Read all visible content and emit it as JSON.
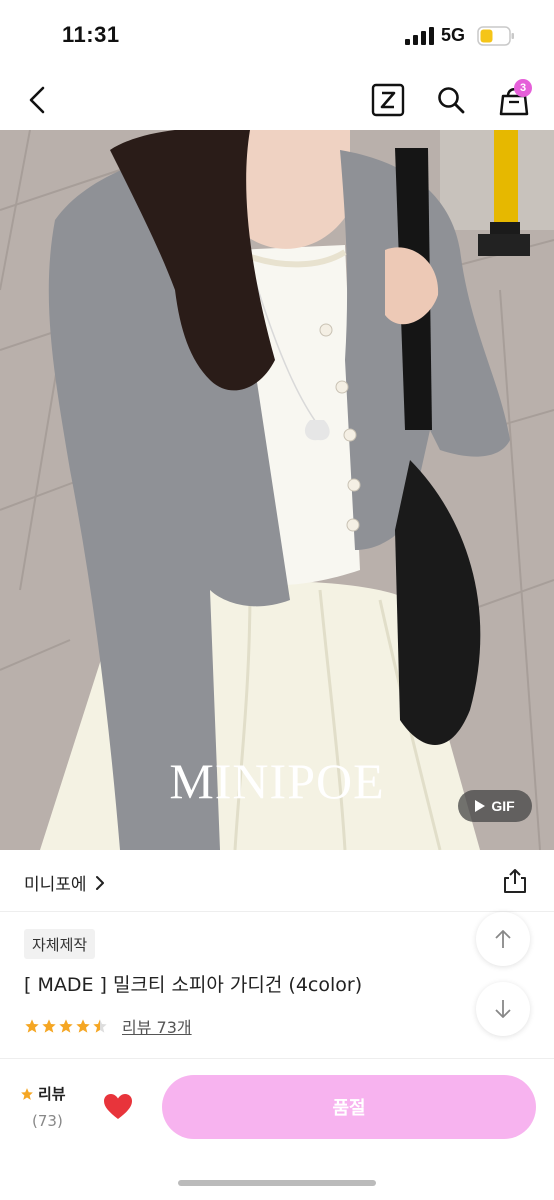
{
  "status_bar": {
    "time": "11:31",
    "network": "5G"
  },
  "nav": {
    "cart_count": "3"
  },
  "product_image": {
    "watermark": "MINIPOE",
    "gif_label": "GIF"
  },
  "store": {
    "name": "미니포에"
  },
  "product": {
    "tag": "자체제작",
    "title": "[ MADE ] 밀크티 소피아 가디건 (4color)",
    "rating_stars": 4.5,
    "review_link": "리뷰 73개"
  },
  "bottom_bar": {
    "review_label": "리뷰",
    "review_count": "(73)",
    "soldout_label": "품절"
  },
  "colors": {
    "accent_pink": "#f7b3ef",
    "badge_pink": "#e55fd9",
    "star": "#f5a623",
    "heart": "#e8343b"
  }
}
